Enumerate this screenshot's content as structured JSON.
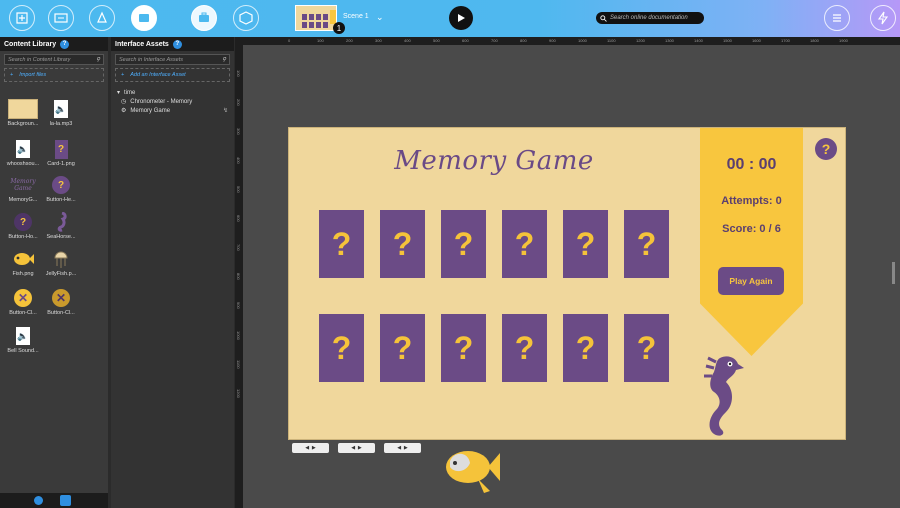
{
  "toolbar": {
    "scene_label": "Scene 1",
    "scene_count": "1",
    "search_placeholder": "Search online documentation"
  },
  "content_library": {
    "title": "Content Library",
    "search_placeholder": "Search in Content Library",
    "import_label": "Import files",
    "items": [
      {
        "name": "Backgroun...",
        "icon": "image-thumb"
      },
      {
        "name": "la-la.mp3",
        "icon": "speaker-icon"
      },
      {
        "name": "whooshsou...",
        "icon": "speaker-icon"
      },
      {
        "name": "Card-1.png",
        "icon": "card-thumb"
      },
      {
        "name": "MemoryG...",
        "icon": "title-thumb"
      },
      {
        "name": "Button-He...",
        "icon": "help-thumb"
      },
      {
        "name": "Button-Ho...",
        "icon": "help-thumb"
      },
      {
        "name": "SeaHorse...",
        "icon": "seahorse-thumb"
      },
      {
        "name": "Fish.png",
        "icon": "fish-thumb"
      },
      {
        "name": "JellyFish.p...",
        "icon": "jellyfish-thumb"
      },
      {
        "name": "Button-Cl...",
        "icon": "close-thumb"
      },
      {
        "name": "Button-Cl...",
        "icon": "close-thumb"
      },
      {
        "name": "Bell Sound...",
        "icon": "speaker-icon"
      }
    ]
  },
  "interface_assets": {
    "title": "Interface Assets",
    "search_placeholder": "Search in Interface Assets",
    "add_label": "Add an Interface Asset",
    "group": "time",
    "rows": [
      "Chronometer - Memory",
      "Memory Game"
    ]
  },
  "stage": {
    "title": "Memory Game",
    "card_symbol": "?",
    "timer": "00 : 00",
    "attempts": "Attempts: 0",
    "score": "Score: 0 / 6",
    "play_again": "Play Again",
    "help": "?"
  },
  "rulers": {
    "top": [
      "0",
      "100",
      "200",
      "300",
      "400",
      "500",
      "600",
      "700",
      "800",
      "900",
      "1000",
      "1100",
      "1200",
      "1300",
      "1400",
      "1500",
      "1600",
      "1700",
      "1800",
      "1900"
    ],
    "left": [
      "100",
      "200",
      "300",
      "400",
      "500",
      "600",
      "700",
      "800",
      "900",
      "1000",
      "1100",
      "1200"
    ]
  },
  "colors": {
    "topbar": "#4cb9ef",
    "card": "#6b4b86",
    "accent": "#f8c63e",
    "stage_bg": "#f0d79c"
  }
}
